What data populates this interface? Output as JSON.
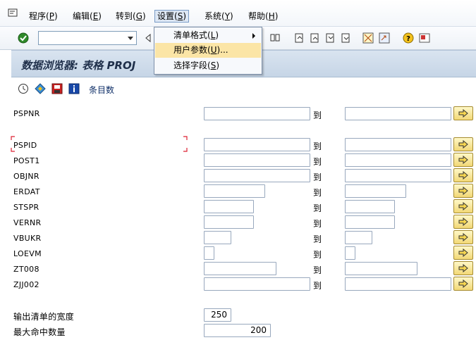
{
  "menubar": {
    "items": [
      {
        "text": "程序(",
        "mn": "P",
        "post": ")"
      },
      {
        "text": "编辑(",
        "mn": "E",
        "post": ")"
      },
      {
        "text": "转到(",
        "mn": "G",
        "post": ")"
      },
      {
        "text": "设置(",
        "mn": "S",
        "post": ")"
      },
      {
        "text": "系统(",
        "mn": "Y",
        "post": ")"
      },
      {
        "text": "帮助(",
        "mn": "H",
        "post": ")"
      }
    ]
  },
  "settings_menu": {
    "items": [
      {
        "text": "清单格式(",
        "mn": "L",
        "post": ")"
      },
      {
        "text": "用户参数(",
        "mn": "U",
        "post": ")..."
      },
      {
        "text": "选择字段(",
        "mn": "S",
        "post": ")"
      }
    ]
  },
  "title": "数据浏览器: 表格 PROJ",
  "app_toolbar": {
    "entries_label": "条目数"
  },
  "form": {
    "to_label": "到",
    "rows": [
      {
        "label": "PSPNR"
      },
      {
        "label": "PSPID"
      },
      {
        "label": "POST1"
      },
      {
        "label": "OBJNR"
      },
      {
        "label": "ERDAT"
      },
      {
        "label": "STSPR"
      },
      {
        "label": "VERNR"
      },
      {
        "label": "VBUKR"
      },
      {
        "label": "LOEVM"
      },
      {
        "label": "ZT008"
      },
      {
        "label": "ZJJ002"
      }
    ],
    "width_label": "输出清单的宽度",
    "width_value": "250",
    "max_hits_label": "最大命中数量",
    "max_hits_value": "200"
  }
}
